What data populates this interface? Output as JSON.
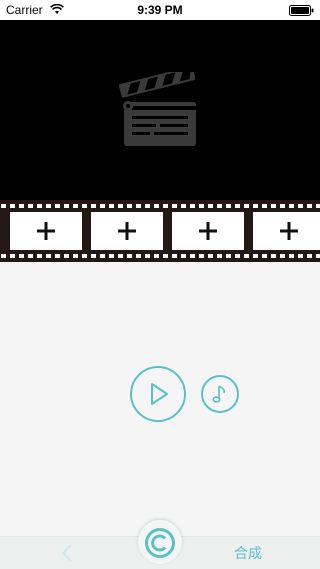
{
  "status_bar": {
    "carrier": "Carrier",
    "time": "9:39 PM"
  },
  "preview": {
    "icon": "clapperboard-icon"
  },
  "film_strip": {
    "frames": [
      {
        "icon": "plus-icon"
      },
      {
        "icon": "plus-icon"
      },
      {
        "icon": "plus-icon"
      },
      {
        "icon": "plus-icon"
      }
    ]
  },
  "controls": {
    "play_icon": "play-icon",
    "music_icon": "music-note-icon"
  },
  "bottom_bar": {
    "back_icon": "chevron-left-icon",
    "logo_icon": "copyright-logo-icon",
    "compose_label": "合成"
  },
  "colors": {
    "accent": "#5bc0c8",
    "film": "#231816",
    "preview_bg": "#000000"
  }
}
